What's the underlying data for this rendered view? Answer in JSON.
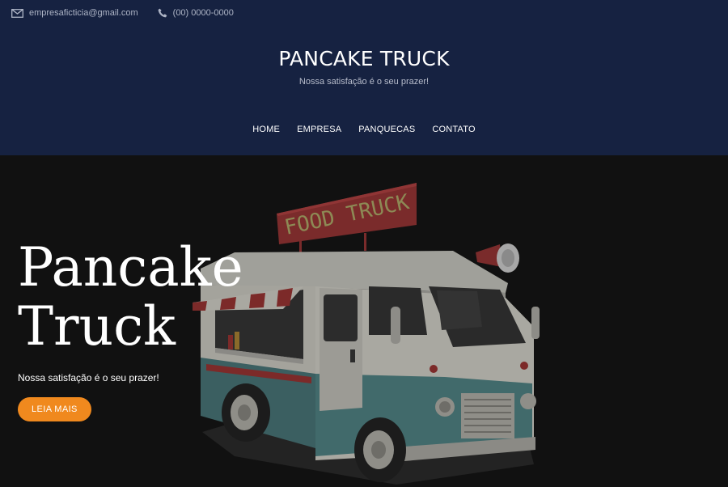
{
  "topbar": {
    "email": "empresaficticia@gmail.com",
    "phone": "(00) 0000-0000",
    "email_icon": "envelope-icon",
    "phone_icon": "phone-icon"
  },
  "brand": {
    "title": "PANCAKE TRUCK",
    "tagline": "Nossa satisfação é o seu prazer!"
  },
  "nav": {
    "items": [
      "HOME",
      "EMPRESA",
      "PANQUECAS",
      "CONTATO"
    ]
  },
  "hero": {
    "title_line1": "Pancake",
    "title_line2": "Truck",
    "subtitle": "Nossa satisfação é o seu prazer!",
    "button": "LEIA MAIS",
    "truck_sign": "FOOD TRUCK"
  },
  "colors": {
    "header_bg": "#162241",
    "hero_bg": "#111111",
    "button": "#f0891e"
  }
}
